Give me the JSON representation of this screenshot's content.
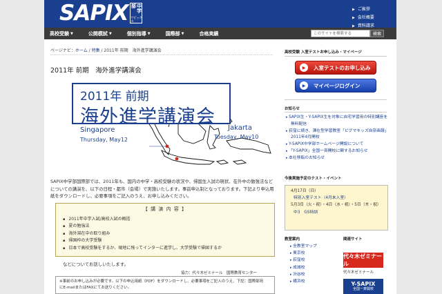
{
  "header": {
    "logo": "SAPIX",
    "logo_badge": "中学部",
    "logo_kana": "サピックス",
    "links": [
      {
        "label": "ご挨拶"
      },
      {
        "label": "会社概要"
      },
      {
        "label": "資料請求"
      }
    ]
  },
  "nav": {
    "items": [
      {
        "label": "高校受験",
        "has_dropdown": true
      },
      {
        "label": "公開模試",
        "has_dropdown": true
      },
      {
        "label": "個別指導",
        "has_dropdown": true
      },
      {
        "label": "国際部",
        "has_dropdown": true
      },
      {
        "label": "合格実績",
        "has_dropdown": false
      }
    ],
    "search_placeholder": "このサイトを検索する",
    "search_button": "検索"
  },
  "breadcrumb": {
    "label": "ページナビ：",
    "home": "ホーム",
    "sep1": " / ",
    "section": "特集",
    "sep2": " / ",
    "current": "2011年 前期　海外進学講演会"
  },
  "main": {
    "title": "2011年 前期　海外進学講演会",
    "banner": {
      "line1": "2011年 前期",
      "line2": "海外進学講演会",
      "city_left": "Singapore",
      "date_left": "Thursday, May12",
      "city_right": "Jakarta",
      "date_right": "Tuesday, May10"
    },
    "intro": "SAPIX中学部国際部では、2011年も、国内の中学・高校受験の状況や、帰国生入試の現状、在外中の勉強法などについての講演を、以下の日程・都市（会場）で実施いたします。事前申込制となっております。下記より申込用紙をダウンロードし、必要事項をご記入のうえ、お申し込みください。",
    "content_heading": "【 講 演 内 容 】",
    "content_items": [
      "2011年中学入試/高校入試の概括",
      "夏の勉強法",
      "海外滞在中の取り組み",
      "帰国枠の大学受験",
      "日本で高校受験をするか、現地に残ってインターに進学し、大学受験で帰国するか"
    ],
    "outro": "などについてお話しいたします。",
    "credit": "協力：代々木ゼミナール　国際教育センター",
    "notice_line1": "※事前のお申し込みが必要です。以下の申込用紙（PDF）をダウンロードし、必要事項をご記入のうえ、下記：国際部宛",
    "notice_line2": "にE-mailまたはFAXにてお送りください。"
  },
  "sidebar": {
    "mock_heading": "高校受験 入室テストお申し込み・マイページ",
    "apply_button": "入室テストのお申し込み",
    "mypage_button": "マイページログイン",
    "news_heading": "お知らせ",
    "news": [
      "SAPIX生・Y-SAPIX生を対象に自宅学習用の特別講座を無料配信",
      "荻窪に続き、渾在型学習教室「ピグマキッズ自奈画報」2011年4月開校",
      "Y-SAPIX中学部ホームページ開設について",
      "「Y-SAPIX」全国一斉開校に関するお知らせ",
      "本社移転のお知らせ"
    ],
    "schedule_heading": "今後実施予定のテスト・イベント",
    "schedule": [
      {
        "text": "4月17日（日）",
        "link": false
      },
      {
        "text": "特別入室テスト（4月末入室）",
        "link": true
      },
      {
        "text": "5月3日（火・祝）・4日（水・祝）・5日（木・祝）",
        "link": false
      },
      {
        "text": "中3　GS特訓",
        "link": true
      }
    ],
    "school_heading": "教室案内",
    "schools": [
      "全教室マップ",
      "東京校",
      "荻窪校",
      "成城校",
      "渋谷校",
      "横浜校"
    ],
    "related_heading": "関連サイト",
    "yoyogi": "代々木ゼミナール",
    "yoyogi_caption": "代々木ゼミナール",
    "ysapix": "Y-SAPIX",
    "ysapix_sub": "全国一斉開校"
  }
}
